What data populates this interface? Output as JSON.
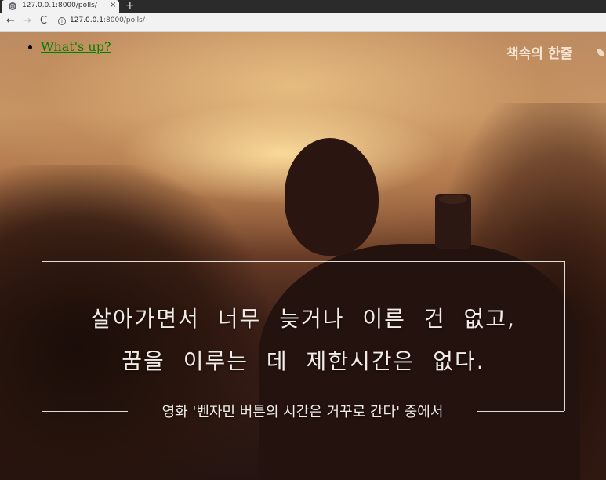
{
  "browser": {
    "tab_title": "127.0.0.1:8000/polls/",
    "tab_close": "×",
    "new_tab": "+",
    "back": "←",
    "forward": "→",
    "reload": "C",
    "url_host": "127.0.0.1",
    "url_path": ":8000/polls/"
  },
  "polls": {
    "items": [
      {
        "label": "What's up?"
      }
    ]
  },
  "image": {
    "brand": "책속의 한줄",
    "quote_line1": "살아가면서 너무 늦거나 이른 건 없고,",
    "quote_line2": "꿈을 이루는 데 제한시간은 없다.",
    "quote_source": "영화 '벤자민 버튼의 시간은 거꾸로 간다' 중에서"
  },
  "colors": {
    "link": "#008000",
    "tabbar": "#2b2b2b",
    "toolbar": "#f2f2f2"
  }
}
